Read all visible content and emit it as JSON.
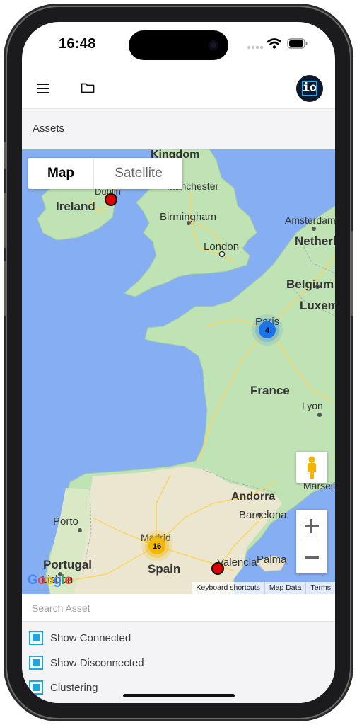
{
  "status_bar": {
    "time": "16:48",
    "icons": [
      "signal-icon",
      "wifi-icon",
      "battery-icon"
    ]
  },
  "app_bar": {
    "left_icons": [
      "menu-icon",
      "folder-icon"
    ],
    "logo_text": "io"
  },
  "section": {
    "title": "Assets"
  },
  "map": {
    "map_type": {
      "options": [
        "Map",
        "Satellite"
      ],
      "selected": "Map"
    },
    "labels": [
      "Kingdom",
      "Dublin",
      "Ireland",
      "Manchester",
      "Birmingham",
      "London",
      "Amsterdam",
      "Netherl",
      "Belgium",
      "Luxem",
      "Paris",
      "France",
      "Lyon",
      "Marseil",
      "Andorra",
      "Barcelona",
      "Porto",
      "Madrid",
      "Portugal",
      "Lisbon",
      "Spain",
      "Valencia",
      "Palma"
    ],
    "clusters": [
      {
        "count": "4",
        "color": "#1a73e8"
      },
      {
        "count": "16",
        "color": "#f5b800"
      }
    ],
    "markers": [
      {
        "color": "#e00000"
      },
      {
        "color": "#e00000"
      }
    ],
    "google_logo": [
      "G",
      "o",
      "o",
      "g",
      "l",
      "e"
    ],
    "google_colors": [
      "#4285f4",
      "#ea4335",
      "#fbbc05",
      "#4285f4",
      "#34a853",
      "#ea4335"
    ],
    "attribution": [
      "Keyboard shortcuts",
      "Map Data",
      "Terms"
    ],
    "colors": {
      "water": "#86aef2",
      "land": "#bfe3b4",
      "spain": "#ebe6cf",
      "roads": "#fcd462"
    }
  },
  "search": {
    "placeholder": "Search Asset",
    "value": ""
  },
  "options": [
    {
      "label": "Show Connected",
      "checked": true
    },
    {
      "label": "Show Disconnected",
      "checked": true
    },
    {
      "label": "Clustering",
      "checked": true
    }
  ],
  "accent_color": "#1ba7e0"
}
